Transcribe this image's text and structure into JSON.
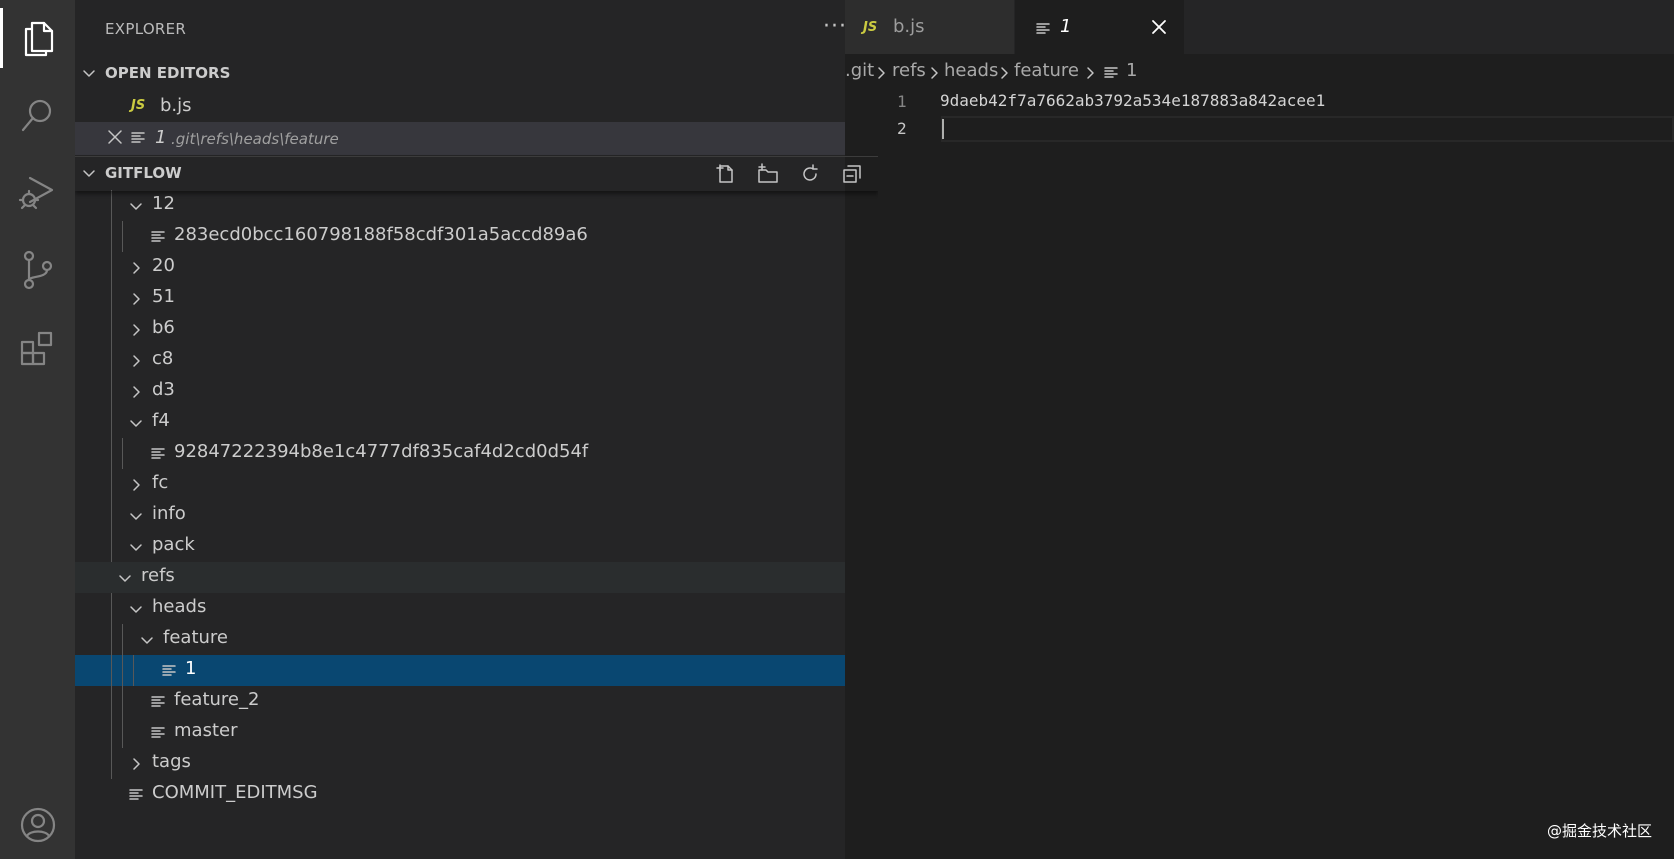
{
  "activity_bar": {
    "items": [
      "files-icon",
      "search-icon",
      "run-debug-icon",
      "source-control-icon",
      "extensions-icon"
    ],
    "account": "account-icon"
  },
  "sidebar": {
    "title": "EXPLORER",
    "more": "···",
    "open_editors": {
      "title": "OPEN EDITORS",
      "items": [
        {
          "badge": "JS",
          "label": "b.js"
        },
        {
          "label": "1",
          "description": ".git\\refs\\heads\\feature"
        }
      ]
    },
    "gitflow": {
      "title": "GITFLOW",
      "actions": [
        "new-file-icon",
        "new-folder-icon",
        "refresh-icon",
        "collapse-all-icon"
      ],
      "tree": [
        {
          "label": "12",
          "type": "folder",
          "expanded": true,
          "depth": 2
        },
        {
          "label": "283ecd0bcc160798188f58cdf301a5accd89a6",
          "type": "file",
          "depth": 3
        },
        {
          "label": "20",
          "type": "folder",
          "expanded": false,
          "depth": 2
        },
        {
          "label": "51",
          "type": "folder",
          "expanded": false,
          "depth": 2
        },
        {
          "label": "b6",
          "type": "folder",
          "expanded": false,
          "depth": 2
        },
        {
          "label": "c8",
          "type": "folder",
          "expanded": false,
          "depth": 2
        },
        {
          "label": "d3",
          "type": "folder",
          "expanded": false,
          "depth": 2
        },
        {
          "label": "f4",
          "type": "folder",
          "expanded": true,
          "depth": 2
        },
        {
          "label": "92847222394b8e1c4777df835caf4d2cd0d54f",
          "type": "file",
          "depth": 3
        },
        {
          "label": "fc",
          "type": "folder",
          "expanded": false,
          "depth": 2
        },
        {
          "label": "info",
          "type": "folder",
          "expanded": true,
          "depth": 2
        },
        {
          "label": "pack",
          "type": "folder",
          "expanded": true,
          "depth": 2
        },
        {
          "label": "refs",
          "type": "folder",
          "expanded": true,
          "depth": 1
        },
        {
          "label": "heads",
          "type": "folder",
          "expanded": true,
          "depth": 2
        },
        {
          "label": "feature",
          "type": "folder",
          "expanded": true,
          "depth": 3
        },
        {
          "label": "1",
          "type": "file",
          "depth": 4,
          "selected": true
        },
        {
          "label": "feature_2",
          "type": "file",
          "depth": 3
        },
        {
          "label": "master",
          "type": "file",
          "depth": 3
        },
        {
          "label": "tags",
          "type": "folder",
          "expanded": false,
          "depth": 2
        },
        {
          "label": "COMMIT_EDITMSG",
          "type": "file",
          "depth": 1
        }
      ]
    }
  },
  "editor": {
    "tabs": [
      {
        "badge": "JS",
        "label": "b.js",
        "active": false
      },
      {
        "label": "1",
        "active": true
      }
    ],
    "breadcrumb": [
      ".git",
      "refs",
      "heads",
      "feature",
      "1"
    ],
    "line_numbers": [
      "1",
      "2"
    ],
    "lines": [
      "9daeb42f7a7662ab3792a534e187883a842acee1",
      ""
    ]
  },
  "watermark": "@掘金技术社区"
}
